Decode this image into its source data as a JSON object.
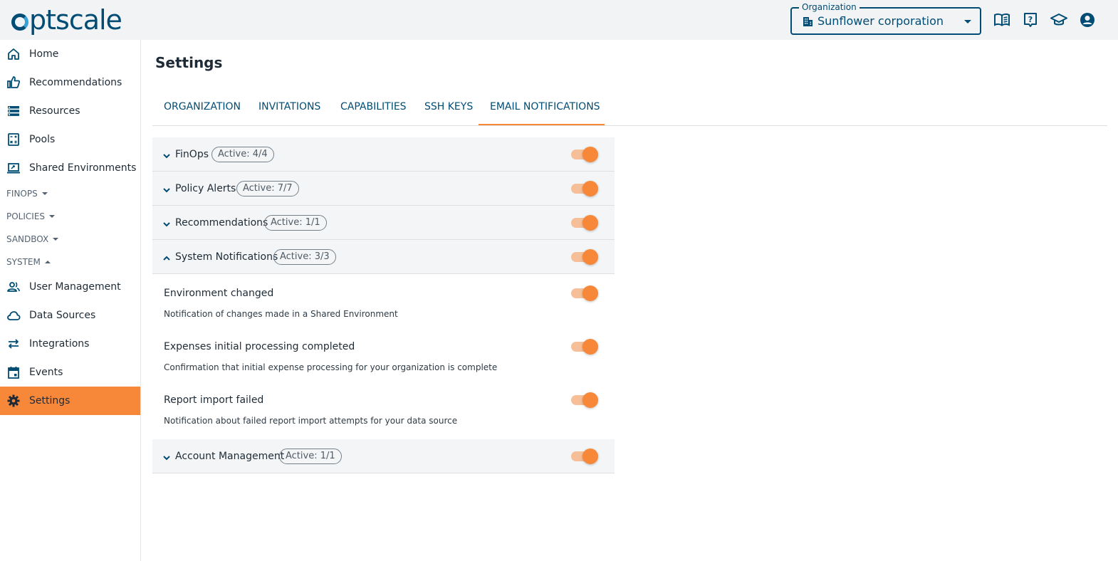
{
  "header": {
    "logo_text": "ptscale",
    "org_label": "Organization",
    "org_value": "Sunflower corporation",
    "icons": [
      "documentation-icon",
      "help-icon",
      "academy-icon",
      "profile-icon"
    ]
  },
  "sidebar": {
    "items": [
      {
        "label": "Home",
        "icon": "home-icon"
      },
      {
        "label": "Recommendations",
        "icon": "thumb-up-icon"
      },
      {
        "label": "Resources",
        "icon": "list-icon"
      },
      {
        "label": "Pools",
        "icon": "calculator-icon"
      },
      {
        "label": "Shared Environments",
        "icon": "laptop-icon"
      }
    ],
    "sections": [
      {
        "label": "FINOPS",
        "expanded": false
      },
      {
        "label": "POLICIES",
        "expanded": false
      },
      {
        "label": "SANDBOX",
        "expanded": false
      },
      {
        "label": "SYSTEM",
        "expanded": true
      }
    ],
    "system_items": [
      {
        "label": "User Management",
        "icon": "users-icon"
      },
      {
        "label": "Data Sources",
        "icon": "cloud-icon"
      },
      {
        "label": "Integrations",
        "icon": "arrows-icon"
      },
      {
        "label": "Events",
        "icon": "calendar-icon"
      },
      {
        "label": "Settings",
        "icon": "gear-icon",
        "active": true
      }
    ]
  },
  "page": {
    "title": "Settings",
    "tabs": [
      {
        "label": "Organization"
      },
      {
        "label": "Invitations"
      },
      {
        "label": "Capabilities"
      },
      {
        "label": "SSH Keys"
      },
      {
        "label": "Email Notifications",
        "active": true
      }
    ]
  },
  "groups": [
    {
      "name": "FinOps",
      "badge": "Active: 4/4",
      "expanded": false,
      "enabled": true
    },
    {
      "name": "Policy Alerts",
      "badge": "Active: 7/7",
      "expanded": false,
      "enabled": true
    },
    {
      "name": "Recommendations",
      "badge": "Active: 1/1",
      "expanded": false,
      "enabled": true
    },
    {
      "name": "System Notifications",
      "badge": "Active: 3/3",
      "expanded": true,
      "enabled": true
    },
    {
      "name": "Account Management",
      "badge": "Active: 1/1",
      "expanded": false,
      "enabled": true
    }
  ],
  "system_notifications": [
    {
      "title": "Environment changed",
      "description": "Notification of changes made in a Shared Environment",
      "enabled": true
    },
    {
      "title": "Expenses initial processing completed",
      "description": "Confirmation that initial expense processing for your organization is complete",
      "enabled": true
    },
    {
      "title": "Report import failed",
      "description": "Notification about failed report import attempts for your data source",
      "enabled": true
    }
  ],
  "colors": {
    "brand": "#004c74",
    "accent": "#f7883a",
    "toggle_track": "#f6bf97"
  }
}
